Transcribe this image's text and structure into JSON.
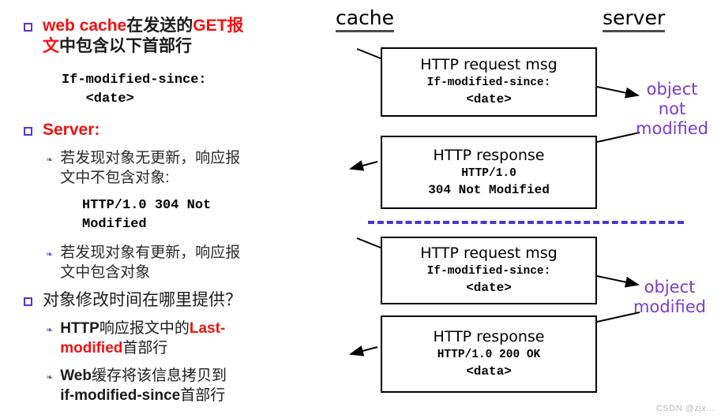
{
  "slide": {
    "background": "#ffffff",
    "accent_red": "#f41111",
    "accent_purple": "#7a3bd6",
    "marker_purple": "#5b33cc"
  },
  "left_column": {
    "items": [
      {
        "level": 1,
        "marker": "square-bullet",
        "lines": [
          [
            {
              "text": "web cache",
              "color": "red"
            },
            {
              "text": "在发送的",
              "color": "dark"
            },
            {
              "text": "GET",
              "color": "red"
            },
            {
              "text": "报",
              "color": "red"
            }
          ],
          [
            {
              "text": "文",
              "color": "red"
            },
            {
              "text": "中包含以下首部行",
              "color": "dark"
            }
          ]
        ]
      },
      {
        "level": "mono",
        "lines": [
          "If-modified-since:",
          "   <date>"
        ]
      },
      {
        "level": 1,
        "marker": "square-bullet",
        "lines": [
          [
            {
              "text": "Server:",
              "color": "red"
            }
          ]
        ]
      },
      {
        "level": 2,
        "marker": "diamond-bullet",
        "lines": [
          [
            {
              "text": "若发现对象无更新，响应报",
              "color": "dark"
            }
          ],
          [
            {
              "text": "文中不包含对象:",
              "color": "dark"
            }
          ]
        ]
      },
      {
        "level": "mono",
        "lines": [
          "HTTP/1.0 304 Not",
          "Modified"
        ]
      },
      {
        "level": 2,
        "marker": "diamond-bullet",
        "lines": [
          [
            {
              "text": "若发现对象有更新，响应报",
              "color": "dark"
            }
          ],
          [
            {
              "text": "文中包含对象",
              "color": "dark"
            }
          ]
        ]
      },
      {
        "level": 1,
        "marker": "square-bullet",
        "lines": [
          [
            {
              "text": "对象修改时间在哪里提供？",
              "color": "dark"
            }
          ]
        ]
      },
      {
        "level": 2,
        "marker": "diamond-bullet",
        "lines": [
          [
            {
              "text": "HTTP",
              "color": "dark"
            },
            {
              "text": "响应报文中的",
              "color": "dark"
            },
            {
              "text": "Last-",
              "color": "red"
            }
          ],
          [
            {
              "text": "modified",
              "color": "red"
            },
            {
              "text": "首部行",
              "color": "dark"
            }
          ]
        ]
      },
      {
        "level": 2,
        "marker": "diamond-bullet",
        "lines": [
          [
            {
              "text": "Web",
              "color": "dark"
            },
            {
              "text": "缓存将该信息拷贝到",
              "color": "dark"
            }
          ],
          [
            {
              "text": "if-modified-since",
              "color": "dark"
            },
            {
              "text": "首部行",
              "color": "dark"
            }
          ]
        ]
      }
    ],
    "text": {
      "i0_l0_a": "web cache",
      "i0_l0_b": "在发送的",
      "i0_l0_c": "GET",
      "i0_l0_d": "报",
      "i0_l1_a": "文",
      "i0_l1_b": "中包含以下首部行",
      "i1_l0": "If-modified-since:",
      "i1_l1": "   <date>",
      "i2_l0": "Server:",
      "i3_l0": "若发现对象无更新，响应报",
      "i3_l1": "文中不包含对象:",
      "i4_l0": "HTTP/1.0 304 Not",
      "i4_l1": "Modified",
      "i5_l0": "若发现对象有更新，响应报",
      "i5_l1": "文中包含对象",
      "i6_l0": "对象修改时间在哪里提供？",
      "i7_l0_a": "HTTP",
      "i7_l0_b": "响应报文中的",
      "i7_l0_c": "Last-",
      "i7_l1_a": "modified",
      "i7_l1_b": "首部行",
      "i8_l0_a": "Web",
      "i8_l0_b": "缓存将该信息拷贝到",
      "i8_l1_a": "if-modified-since",
      "i8_l1_b": "首部行"
    }
  },
  "diagram": {
    "headings": {
      "left": "cache",
      "right": "server"
    },
    "boxes": [
      {
        "id": "request-1",
        "title": "HTTP request msg",
        "line2": "If-modified-since:",
        "line3": "<date>"
      },
      {
        "id": "response-1",
        "title": "HTTP response",
        "line2": "HTTP/1.0",
        "line3": "304 Not Modified"
      },
      {
        "id": "request-2",
        "title": "HTTP request msg",
        "line2": "If-modified-since:",
        "line3": "<date>"
      },
      {
        "id": "response-2",
        "title": "HTTP response",
        "line2": "HTTP/1.0 200 OK",
        "line3": "<data>"
      }
    ],
    "notes": {
      "top": [
        "object",
        "not",
        "modified"
      ],
      "bottom": [
        "object",
        "modified"
      ]
    }
  },
  "watermark": "CSDN @zjx..."
}
